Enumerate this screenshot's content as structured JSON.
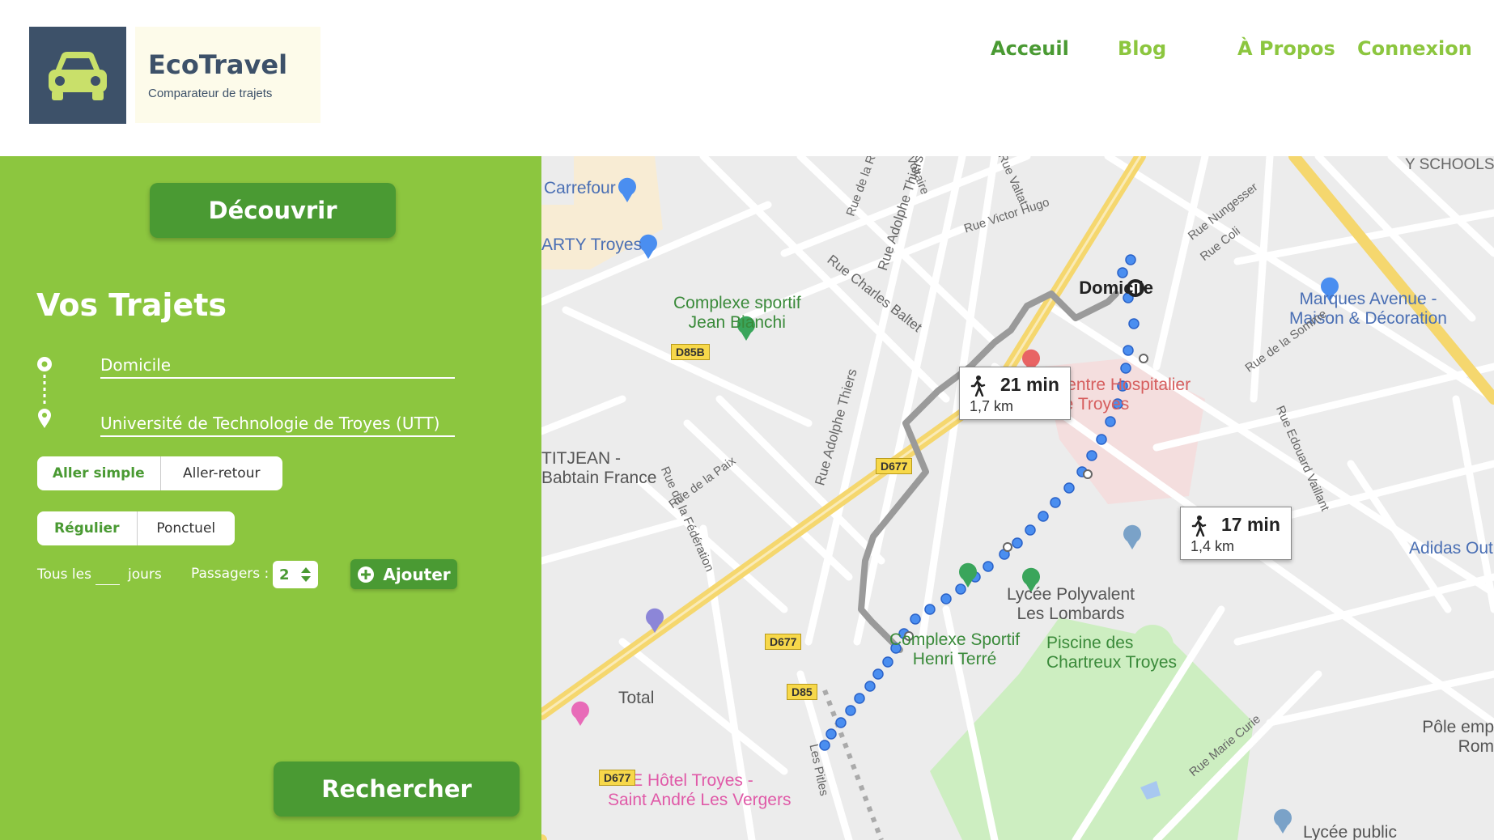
{
  "header": {
    "brand_name": "EcoTravel",
    "brand_tagline": "Comparateur de trajets",
    "nav": [
      "Acceuil",
      "Blog",
      "À Propos",
      "Connexion"
    ],
    "colors": {
      "logo_bg": "#3d5169",
      "accent": "#8cc63f",
      "dark_green": "#4a9a33"
    }
  },
  "sidebar": {
    "discover_label": "Découvrir",
    "title": "Vos Trajets",
    "origin": "Domicile",
    "destination": "Université de Technologie de Troyes (UTT)",
    "trip_type": {
      "options": [
        "Aller simple",
        "Aller-retour"
      ],
      "selected": "Aller simple"
    },
    "frequency": {
      "options": [
        "Régulier",
        "Ponctuel"
      ],
      "selected": "Régulier"
    },
    "every_label": "Tous les",
    "every_value": "",
    "days_label": "jours",
    "passengers_label": "Passagers :",
    "passengers_value": "2",
    "add_label": "Ajouter",
    "search_label": "Rechercher"
  },
  "map": {
    "origin_label": "Domicile",
    "route_a": {
      "time": "21 min",
      "distance": "1,7 km"
    },
    "route_b": {
      "time": "17 min",
      "distance": "1,4 km"
    },
    "pois": {
      "carrefour": "Carrefour",
      "arty": "ARTY Troyes",
      "complexe1": [
        "Complexe sportif",
        "Jean Bianchi"
      ],
      "hospital": [
        "Centre Hospitalier",
        "de Troyes"
      ],
      "marques": [
        "Marques Avenue -",
        "Maison & Décoration"
      ],
      "titjean": [
        "TITJEAN -",
        "Babtain France"
      ],
      "lycee": [
        "Lycée Polyvalent",
        "Les Lombards"
      ],
      "complexe2": [
        "Complexe Sportif",
        "Henri Terré"
      ],
      "piscine": [
        "Piscine des",
        "Chartreux Troyes"
      ],
      "total": "Total",
      "hotel": [
        "ACE Hôtel Troyes -",
        "Saint André Les Vergers"
      ],
      "adidas": "Adidas Out",
      "pole": [
        "Pôle emp",
        "Rom"
      ],
      "lycee_public": "Lycée public",
      "schools": "Y SCHOOLS"
    },
    "streets": [
      "Rue Charles Baltet",
      "Rue Adolphe Thiers",
      "Rue Adolphe Thiers",
      "Rue Victor Hugo",
      "Rue de la Rép",
      "Voltaire",
      "Rue Valtat",
      "Rue Nungesser",
      "Rue Coli",
      "Rue de la Somme",
      "Rue Edouard Vaillant",
      "Rue de la Paix",
      "Rue de la Fédération",
      "Les Pitles",
      "Rue Marie Curie"
    ],
    "shields": [
      "D85B",
      "D677",
      "D677",
      "D85",
      "D677"
    ]
  }
}
